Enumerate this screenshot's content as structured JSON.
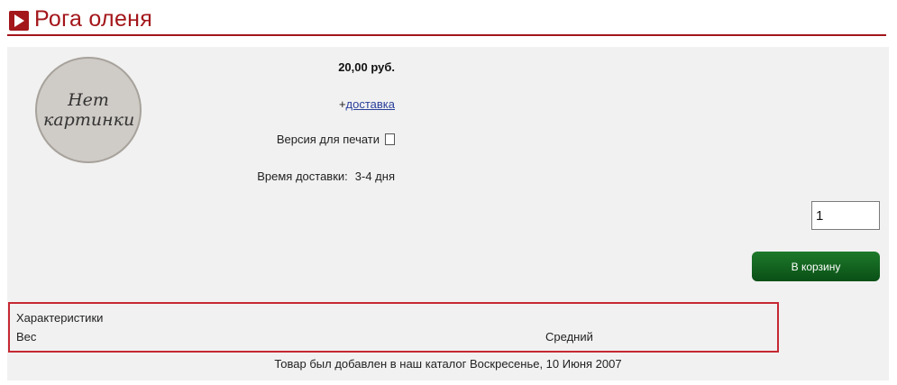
{
  "title": "Рога оленя",
  "colors": {
    "accent": "#a3161a",
    "button": "#0f5c1d",
    "highlight": "#c62833"
  },
  "product": {
    "image_placeholder": "Нет картинки",
    "price": "20,00 руб.",
    "delivery_prefix": "+",
    "delivery_link": "доставка",
    "print_label": "Версия для печати",
    "delivery_time_label": "Время доставки:",
    "delivery_time_value": "3-4 дня"
  },
  "cart": {
    "quantity": "1",
    "button_label": "В корзину"
  },
  "characteristics": {
    "heading": "Характеристики",
    "rows": [
      {
        "label": "Вес",
        "value": "Средний"
      }
    ]
  },
  "added_text": "Товар был добавлен в наш каталог Воскресенье, 10 Июня 2007"
}
